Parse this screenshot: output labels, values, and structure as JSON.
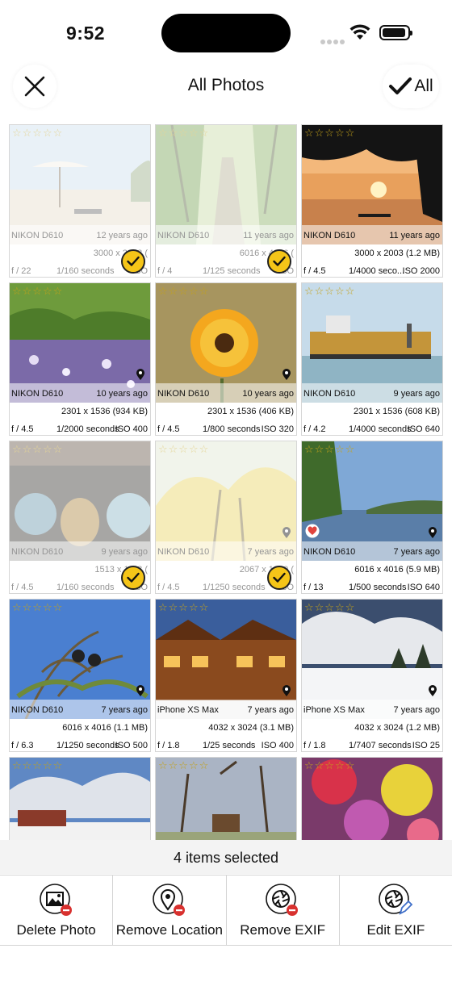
{
  "status_bar": {
    "time": "9:52"
  },
  "nav": {
    "title": "All Photos",
    "select_all_label": "All"
  },
  "photos": [
    {
      "camera": "NIKON D610",
      "age": "12 years ago",
      "dims": "3000 x 2003 (",
      "fstop": "f / 22",
      "shutter": "1/160 seconds",
      "iso": "ISO",
      "selected": true,
      "location": false,
      "heart": false
    },
    {
      "camera": "NIKON D610",
      "age": "11 years ago",
      "dims": "6016 x 4016 (",
      "fstop": "f / 4",
      "shutter": "1/125 seconds",
      "iso": "ISO",
      "selected": true,
      "location": false,
      "heart": false
    },
    {
      "camera": "NIKON D610",
      "age": "11 years ago",
      "dims": "3000 x 2003 (1.2 MB)",
      "fstop": "f / 4.5",
      "shutter": "1/4000 seco...",
      "iso": "ISO 2000",
      "selected": false,
      "location": false,
      "heart": false
    },
    {
      "camera": "NIKON D610",
      "age": "10 years ago",
      "dims": "2301 x 1536 (934 KB)",
      "fstop": "f / 4.5",
      "shutter": "1/2000 seconds",
      "iso": "ISO 400",
      "selected": false,
      "location": true,
      "heart": false
    },
    {
      "camera": "NIKON D610",
      "age": "10 years ago",
      "dims": "2301 x 1536 (406 KB)",
      "fstop": "f / 4.5",
      "shutter": "1/800 seconds",
      "iso": "ISO 320",
      "selected": false,
      "location": true,
      "heart": false
    },
    {
      "camera": "NIKON D610",
      "age": "9 years ago",
      "dims": "2301 x 1536 (608 KB)",
      "fstop": "f / 4.2",
      "shutter": "1/4000 seconds",
      "iso": "ISO 640",
      "selected": false,
      "location": false,
      "heart": false
    },
    {
      "camera": "NIKON D610",
      "age": "9 years ago",
      "dims": "1513 x 1118 (",
      "fstop": "f / 4.5",
      "shutter": "1/160 seconds",
      "iso": "ISO",
      "selected": true,
      "location": false,
      "heart": false
    },
    {
      "camera": "NIKON D610",
      "age": "7 years ago",
      "dims": "2067 x 1290 (",
      "fstop": "f / 4.5",
      "shutter": "1/1250 seconds",
      "iso": "ISO",
      "selected": true,
      "location": true,
      "heart": false
    },
    {
      "camera": "NIKON D610",
      "age": "7 years ago",
      "dims": "6016 x 4016 (5.9 MB)",
      "fstop": "f / 13",
      "shutter": "1/500 seconds",
      "iso": "ISO 640",
      "selected": false,
      "location": true,
      "heart": true
    },
    {
      "camera": "NIKON D610",
      "age": "7 years ago",
      "dims": "6016 x 4016 (1.1 MB)",
      "fstop": "f / 6.3",
      "shutter": "1/1250 seconds",
      "iso": "ISO 500",
      "selected": false,
      "location": true,
      "heart": false
    },
    {
      "camera": "iPhone XS Max",
      "age": "7 years ago",
      "dims": "4032 x 3024 (3.1 MB)",
      "fstop": "f / 1.8",
      "shutter": "1/25 seconds",
      "iso": "ISO 400",
      "selected": false,
      "location": true,
      "heart": false
    },
    {
      "camera": "iPhone XS Max",
      "age": "7 years ago",
      "dims": "4032 x 3024 (1.2 MB)",
      "fstop": "f / 1.8",
      "shutter": "1/7407 seconds",
      "iso": "ISO 25",
      "selected": false,
      "location": true,
      "heart": false
    }
  ],
  "footer": {
    "selected_text": "4 items selected",
    "actions": [
      {
        "label": "Delete Photo",
        "icon": "photo-minus-icon"
      },
      {
        "label": "Remove Location",
        "icon": "location-minus-icon"
      },
      {
        "label": "Remove EXIF",
        "icon": "aperture-minus-icon"
      },
      {
        "label": "Edit EXIF",
        "icon": "aperture-edit-icon"
      }
    ]
  },
  "colors": {
    "accent": "#f5c518",
    "star": "#c4a21a",
    "heart": "#e0443e"
  }
}
